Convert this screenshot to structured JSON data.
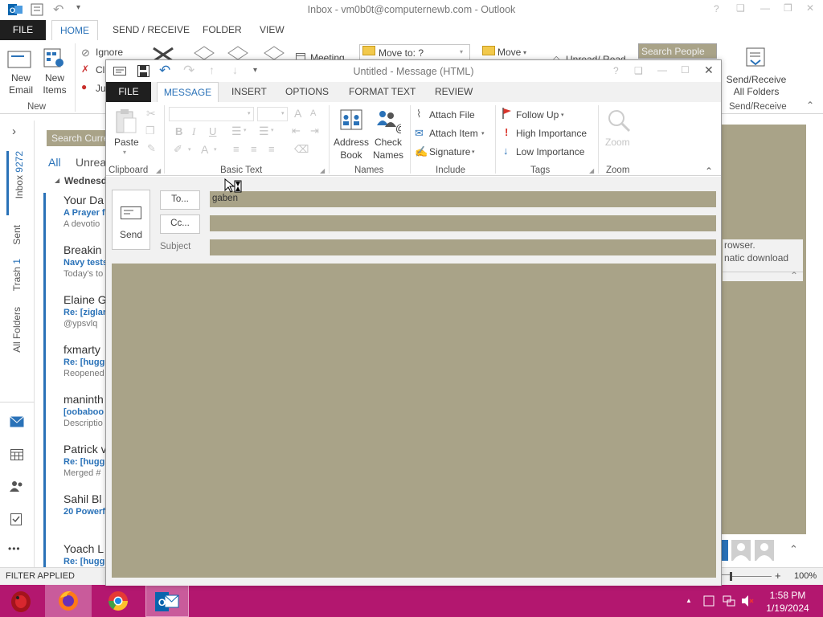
{
  "main_window": {
    "title": "Inbox - vm0b0t@computernewb.com - Outlook",
    "title_controls": [
      "?",
      "❑",
      "—",
      "❒",
      "✕"
    ],
    "tabs": [
      "FILE",
      "HOME",
      "SEND / RECEIVE",
      "FOLDER",
      "VIEW"
    ],
    "ribbon": {
      "new_email": "New\nEmail",
      "new_items": "New\nItems",
      "new_group": "New",
      "ignore": "Ignore",
      "clean_up": "Cl",
      "junk": "Ju",
      "meeting": "Meeting",
      "move_to": "Move to: ?",
      "move": "Move",
      "unread_read": "Unread/ Read",
      "search_people_placeholder": "Search People",
      "send_receive_all": "Send/Receive\nAll Folders",
      "send_receive_group": "Send/Receive"
    },
    "nav_rail": {
      "chevron": "›",
      "folders": [
        {
          "label": "Inbox",
          "count": "9272"
        },
        {
          "label": "Sent",
          "count": ""
        },
        {
          "label": "Trash",
          "count": "1"
        },
        {
          "label": "All Folders",
          "count": ""
        }
      ],
      "more": "•••"
    },
    "mail_list": {
      "search_placeholder": "Search Curre",
      "filter_all": "All",
      "filter_unread": "Unrea",
      "date_group": "Wednesda",
      "items": [
        {
          "sender": "Your Da",
          "subject": "A Prayer f",
          "preview": "A devotio"
        },
        {
          "sender": "Breakin",
          "subject": "Navy tests",
          "preview": "Today's to"
        },
        {
          "sender": "Elaine G",
          "subject": "Re: [ziglar",
          "preview": "@ypsvlq"
        },
        {
          "sender": "fxmarty",
          "subject": "Re: [hugg",
          "preview": "Reopened"
        },
        {
          "sender": "maninth",
          "subject": "[oobaboo",
          "preview": "Descriptio"
        },
        {
          "sender": "Patrick v",
          "subject": "Re: [hugg",
          "preview": "Merged #"
        },
        {
          "sender": "Sahil Bl",
          "subject": "20 Powerf",
          "preview": ""
        },
        {
          "sender": "Yoach L",
          "subject": "Re: [hugg",
          "preview": ""
        }
      ]
    },
    "reading_pane": {
      "line1": "rowser.",
      "line2": "natic download"
    },
    "status": {
      "filter_applied": "FILTER APPLIED",
      "zoom_minus": "—",
      "zoom_plus": "+",
      "zoom": "100%"
    }
  },
  "compose": {
    "title": "Untitled - Message (HTML)",
    "title_controls": [
      "?",
      "❑",
      "—",
      "☐",
      "✕"
    ],
    "quick_access": [
      "↶",
      "↷",
      "↑",
      "↓",
      "▾"
    ],
    "tabs": [
      "FILE",
      "MESSAGE",
      "INSERT",
      "OPTIONS",
      "FORMAT TEXT",
      "REVIEW"
    ],
    "active_tab": "MESSAGE",
    "ribbon": {
      "paste": "Paste",
      "clipboard_group": "Clipboard",
      "basic_text_group": "Basic Text",
      "bold": "B",
      "italic": "I",
      "underline": "U",
      "font_grow": "A",
      "font_color": "A",
      "address_book": "Address\nBook",
      "check_names": "Check\nNames",
      "names_group": "Names",
      "attach_file": "Attach File",
      "attach_item": "Attach Item",
      "signature": "Signature",
      "include_group": "Include",
      "follow_up": "Follow Up",
      "high_importance": "High Importance",
      "low_importance": "Low Importance",
      "tags_group": "Tags",
      "zoom": "Zoom",
      "zoom_group": "Zoom",
      "collapse": "⌃"
    },
    "fields": {
      "send": "Send",
      "to_button": "To...",
      "to_value": "gaben",
      "cc_button": "Cc...",
      "cc_value": "",
      "subject_label": "Subject",
      "subject_value": ""
    }
  },
  "taskbar": {
    "time": "1:58 PM",
    "date": "1/19/2024",
    "tray_arrow": "▲"
  },
  "colors": {
    "accent": "#2a72b8",
    "field_fill": "#a9a388",
    "taskbar": "#b3176f",
    "file_tab": "#1f1f1f"
  }
}
